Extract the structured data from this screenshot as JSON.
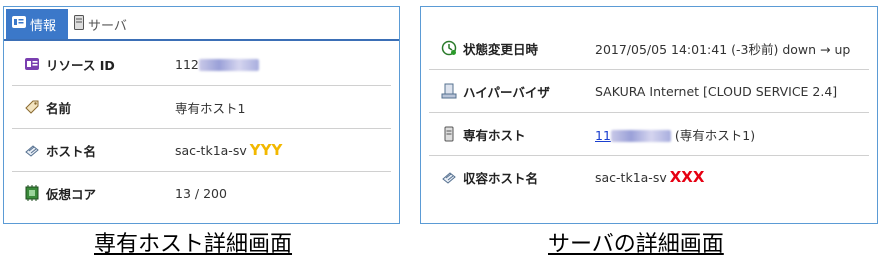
{
  "left": {
    "tabs": [
      {
        "label": "情報",
        "icon": "info-card-icon",
        "active": true
      },
      {
        "label": "サーバ",
        "icon": "server-icon",
        "active": false
      }
    ],
    "rows": [
      {
        "label": "リソース ID",
        "icon": "id-card-icon",
        "value": "112"
      },
      {
        "label": "名前",
        "icon": "tag-icon",
        "value": "専有ホスト1"
      },
      {
        "label": "ホスト名",
        "icon": "host-icon",
        "value": "sac-tk1a-sv",
        "annotation": "YYY"
      },
      {
        "label": "仮想コア",
        "icon": "cpu-icon",
        "value": "13 / 200"
      }
    ],
    "caption": "専有ホスト詳細画面"
  },
  "right": {
    "rows": [
      {
        "label": "状態変更日時",
        "icon": "clock-icon",
        "value": "2017/05/05 14:01:41 (-3秒前) down → up"
      },
      {
        "label": "ハイパーバイザ",
        "icon": "hypervisor-icon",
        "value": "SAKURA Internet [CLOUD SERVICE 2.4]"
      },
      {
        "label": "専有ホスト",
        "icon": "server-icon",
        "value_link": "11",
        "value_suffix": " (専有ホスト1)"
      },
      {
        "label": "収容ホスト名",
        "icon": "host-icon",
        "value": "sac-tk1a-sv",
        "annotation": "XXX"
      }
    ],
    "caption": "サーバの詳細画面"
  },
  "colors": {
    "accent": "#3b78c9",
    "border": "#5b9bd5",
    "yellow": "#f2b800",
    "red": "#e60012",
    "link": "#1a3fcf"
  }
}
